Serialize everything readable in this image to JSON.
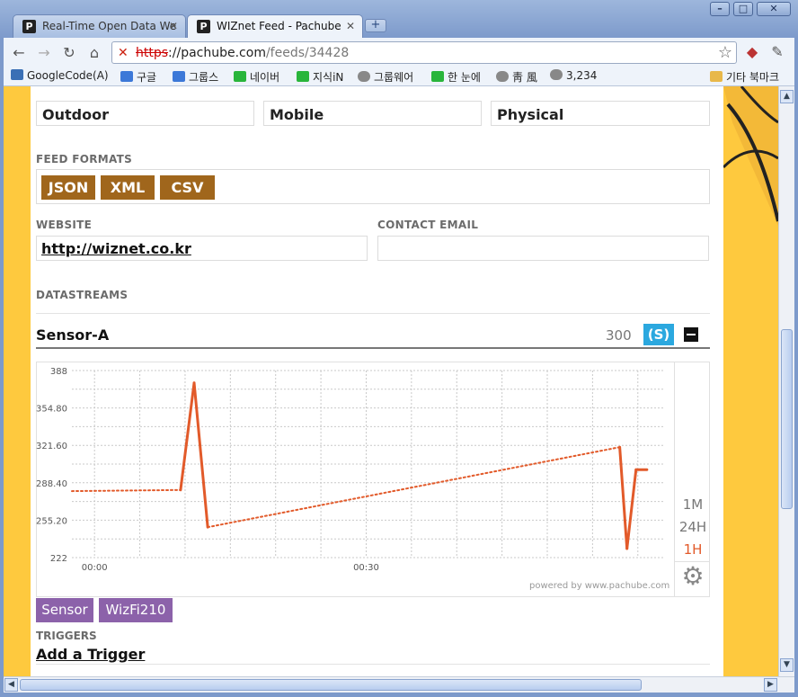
{
  "browser": {
    "tabs": [
      {
        "title": "Real-Time Open Data We",
        "active": false
      },
      {
        "title": "WIZnet Feed - Pachube",
        "active": true
      }
    ],
    "url": {
      "scheme": "https",
      "host": "://pachube.com",
      "path": "/feeds/34428"
    },
    "bookmarks": [
      "GoogleCode(A)",
      "구글",
      "그룹스",
      "네이버",
      "지식iN",
      "그룹웨어",
      "한 눈에",
      "靑 風",
      "3,234",
      "기타 북마크"
    ]
  },
  "feed": {
    "exposure_value": "Outdoor",
    "disposition_value": "Mobile",
    "domain_value": "Physical",
    "formats_label": "FEED FORMATS",
    "formats": [
      "JSON",
      "XML",
      "CSV"
    ],
    "website_label": "WEBSITE",
    "website_value": "http://wiznet.co.kr",
    "contact_label": "CONTACT EMAIL",
    "contact_value": "",
    "datastreams_label": "DATASTREAMS",
    "datastream": {
      "name": "Sensor-A",
      "value": "300",
      "unit": "(S)"
    },
    "ranges": [
      "1M",
      "24H",
      "1H"
    ],
    "active_range": "1H",
    "powered_by": "powered by www.pachube.com",
    "tags": [
      "Sensor",
      "WizFi210"
    ],
    "triggers_label": "TRIGGERS",
    "add_trigger": "Add a Trigger"
  },
  "chart_data": {
    "type": "line",
    "x_tick_labels": [
      "00:00",
      "00:30"
    ],
    "y_tick_labels": [
      "388",
      "354.80",
      "321.60",
      "288.40",
      "255.20",
      "222"
    ],
    "ylim": [
      222,
      388
    ],
    "xlim": [
      -2.5,
      63
    ],
    "grid": true,
    "series": [
      {
        "points": [
          [
            -2.5,
            281
          ],
          [
            9.5,
            282
          ],
          [
            11,
            377
          ],
          [
            12.5,
            249
          ],
          [
            58,
            320
          ],
          [
            58.8,
            230
          ],
          [
            59.8,
            300
          ],
          [
            61,
            300
          ]
        ],
        "dotted_segments": [
          [
            0,
            1
          ],
          [
            3,
            4
          ]
        ],
        "color": "#e25a2a"
      }
    ]
  }
}
